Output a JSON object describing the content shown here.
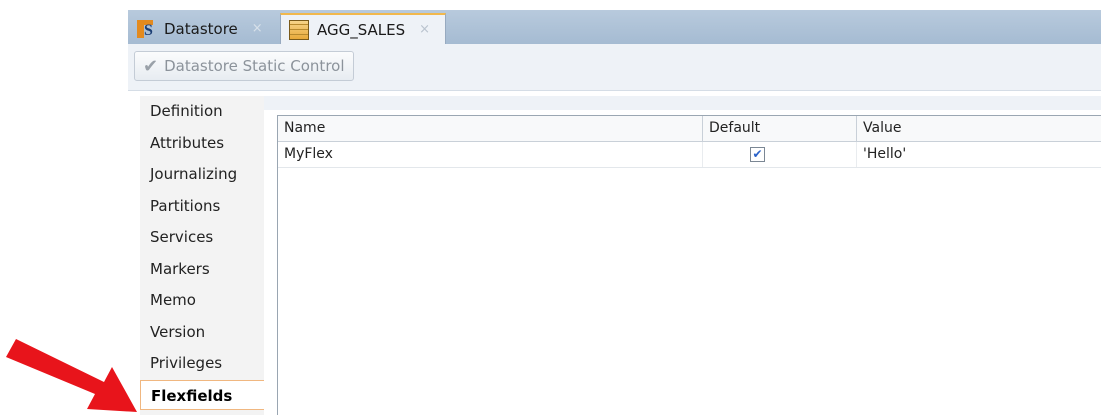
{
  "tabs": [
    {
      "label": "Datastore",
      "icon": "datastore-icon",
      "close": "×",
      "active": false
    },
    {
      "label": "AGG_SALES",
      "icon": "table-icon",
      "close": "×",
      "active": true
    }
  ],
  "toolbar": {
    "static_control_label": "Datastore Static Control",
    "check_glyph": "✔"
  },
  "nav": {
    "items": [
      "Definition",
      "Attributes",
      "Journalizing",
      "Partitions",
      "Services",
      "Markers",
      "Memo",
      "Version",
      "Privileges",
      "Flexfields"
    ],
    "selected": "Flexfields"
  },
  "flexfields_table": {
    "columns": [
      "Name",
      "Default",
      "Value"
    ],
    "rows": [
      {
        "name": "MyFlex",
        "default": true,
        "default_glyph": "✔",
        "value": "'Hello'"
      }
    ]
  },
  "colors": {
    "annotation_arrow": "#e8141b",
    "active_tab_accent": "#f1b84d"
  }
}
